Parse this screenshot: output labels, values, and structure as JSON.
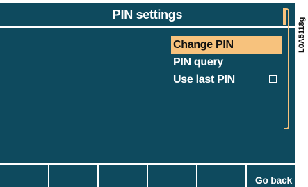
{
  "title": "PIN settings",
  "menu": {
    "items": [
      {
        "label": "Change PIN",
        "selected": true
      },
      {
        "label": "PIN query",
        "selected": false
      },
      {
        "label": "Use last PIN",
        "selected": false,
        "checkbox": false
      }
    ]
  },
  "softkeys": [
    "",
    "",
    "",
    "",
    "",
    "Go back"
  ],
  "figure_code": "L0A5118g",
  "colors": {
    "background": "#0e4a5e",
    "highlight": "#f7c27d",
    "text": "#ffffff"
  }
}
